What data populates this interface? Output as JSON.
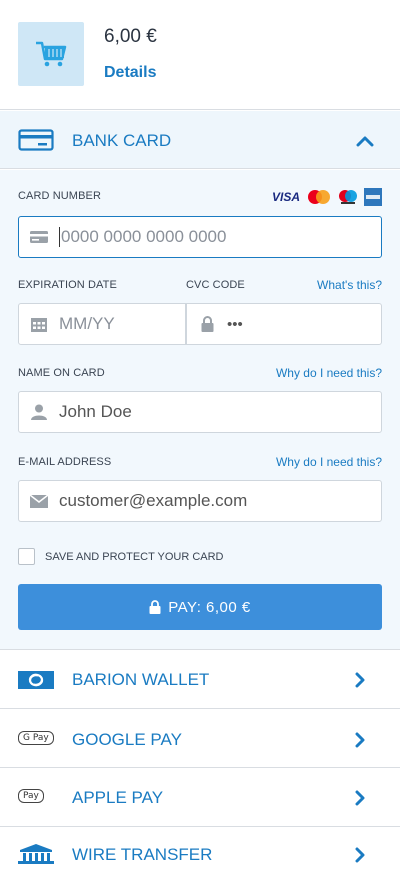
{
  "header": {
    "amount": "6,00 €",
    "details_label": "Details",
    "cart_icon": "shopping-cart-icon"
  },
  "bank_card": {
    "title": "BANK CARD",
    "expanded": true,
    "card_number": {
      "label": "CARD NUMBER",
      "placeholder": "0000 0000 0000 0000",
      "brands": [
        "VISA",
        "Mastercard",
        "Maestro",
        "American Express"
      ]
    },
    "expiration": {
      "label": "EXPIRATION DATE",
      "placeholder": "MM/YY"
    },
    "cvc": {
      "label": "CVC CODE",
      "help": "What's this?",
      "placeholder": "•••"
    },
    "name": {
      "label": "NAME ON CARD",
      "help": "Why do I need this?",
      "placeholder": "John Doe"
    },
    "email": {
      "label": "E-MAIL ADDRESS",
      "help": "Why do I need this?",
      "placeholder": "customer@example.com"
    },
    "save_card_label": "SAVE AND PROTECT YOUR CARD",
    "save_card_checked": false,
    "pay_label": "PAY:",
    "pay_amount": "6,00 €"
  },
  "methods": [
    {
      "title": "BARION WALLET",
      "icon": "barion-wallet-icon"
    },
    {
      "title": "GOOGLE PAY",
      "icon": "google-pay-icon",
      "badge": "G Pay"
    },
    {
      "title": "APPLE PAY",
      "icon": "apple-pay-icon",
      "badge": " Pay"
    },
    {
      "title": "WIRE TRANSFER",
      "icon": "bank-building-icon"
    }
  ],
  "colors": {
    "accent": "#1a7bc2",
    "button": "#3d8fdb",
    "panel_bg": "#f2f8fd"
  }
}
